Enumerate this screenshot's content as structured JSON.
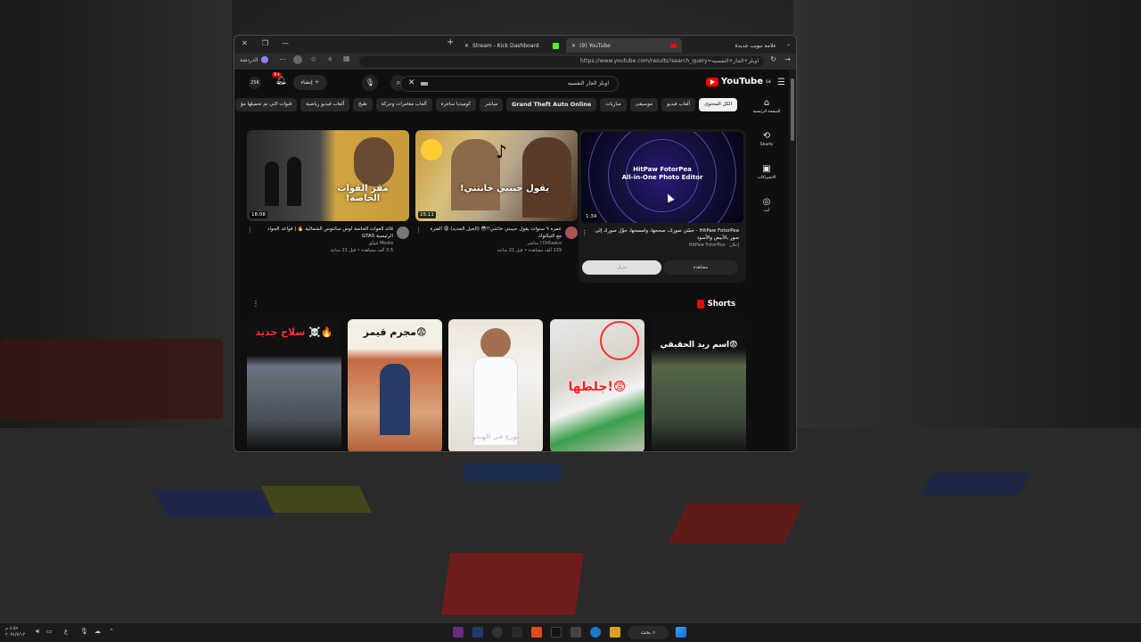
{
  "tabs": [
    {
      "label": "علامة تبويب جديدة"
    },
    {
      "label": "(9) YouTube"
    },
    {
      "label": "Stream - Kick Dashboard"
    }
  ],
  "window_controls": {
    "close": "✕",
    "restore": "❐",
    "minimize": "—",
    "new_tab": "+"
  },
  "address_bar": {
    "url": "https://www.youtube.com/results?search_query=اوبلز+الجار+النفسيه",
    "profile_label": "الدردشة"
  },
  "masthead": {
    "logo_text": "YouTube",
    "logo_sup": "SA",
    "search_query": "اوبلز الجار النفسيه",
    "create_label": "إنشاء",
    "notif_count": "9+",
    "avatar_label": "25K"
  },
  "chips": [
    "الكل المحتوى",
    "ألعاب فيديو",
    "موسيقى",
    "مباريات",
    "Grand Theft Auto Online",
    "مباشر",
    "كوميديا ساخرة",
    "ألعاب مغامرات وحركة",
    "طبخ",
    "ألعاب فيديو رياضية",
    "قنوات التي تم تحميلها مؤ"
  ],
  "sidenav": [
    {
      "icon": "home-icon",
      "glyph": "⌂",
      "label": "الصفحة الرئيسية"
    },
    {
      "icon": "shorts-icon",
      "glyph": "⟲",
      "label": "Shorts"
    },
    {
      "icon": "subscriptions-icon",
      "glyph": "▣",
      "label": "الاشتراكات"
    },
    {
      "icon": "you-icon",
      "glyph": "◎",
      "label": "أنت"
    }
  ],
  "ad": {
    "thumb_line1": "HitPaw FotorPea",
    "thumb_line2": "All-in-One Photo Editor",
    "duration": "1:34",
    "title": "HitPaw FotorPea - حسّن صورك، صححها، وامسحها، حوّل صورك إلى صور بالأبيض والأسود",
    "sponsor": "إعلان · HitPaw FotorPea",
    "watch_label": "مشاهدة",
    "other_label": "تنزيل"
  },
  "videos": [
    {
      "thumb_text": "يقول حبيبي خانتني!",
      "duration": "15:11",
      "title": "عمره ٩ سنوات يقول حبيبتي خانتني!!😳 (الجيل الجديد) 😩 الفترة مع التيكتوك",
      "channel": "DrKaaLo / مباشر",
      "meta": "139 ألف مشاهدة • قبل 21 ساعة"
    },
    {
      "thumb_text": "مقر القوات الخاصة!",
      "duration": "18:08",
      "title": "قائد القوات الخاصة لوس سانتوس الشمالية 🔥 | قواعد الجواد الرئيسية GTA5",
      "channel": "Mosta مُوثّق",
      "meta": "3.5 ألف مشاهدة • قبل 21 ساعة"
    }
  ],
  "shorts_header": "Shorts",
  "shorts": [
    {
      "title": "اسم ريد الحقيقي😨"
    },
    {
      "title": "جلطها!😨"
    },
    {
      "title": "تورع في الهيدو"
    },
    {
      "title": "مجرم قيمز😨"
    },
    {
      "title": "سلاح جديد ☠️🔥"
    }
  ],
  "taskbar": {
    "search_label": "بحث",
    "time": "٤:٥٩ م",
    "date": "٢٠٢٤/٧/١٢",
    "lang": "ع"
  },
  "colors": {
    "accent": "#ff0000",
    "bg": "#0f0f0f"
  }
}
